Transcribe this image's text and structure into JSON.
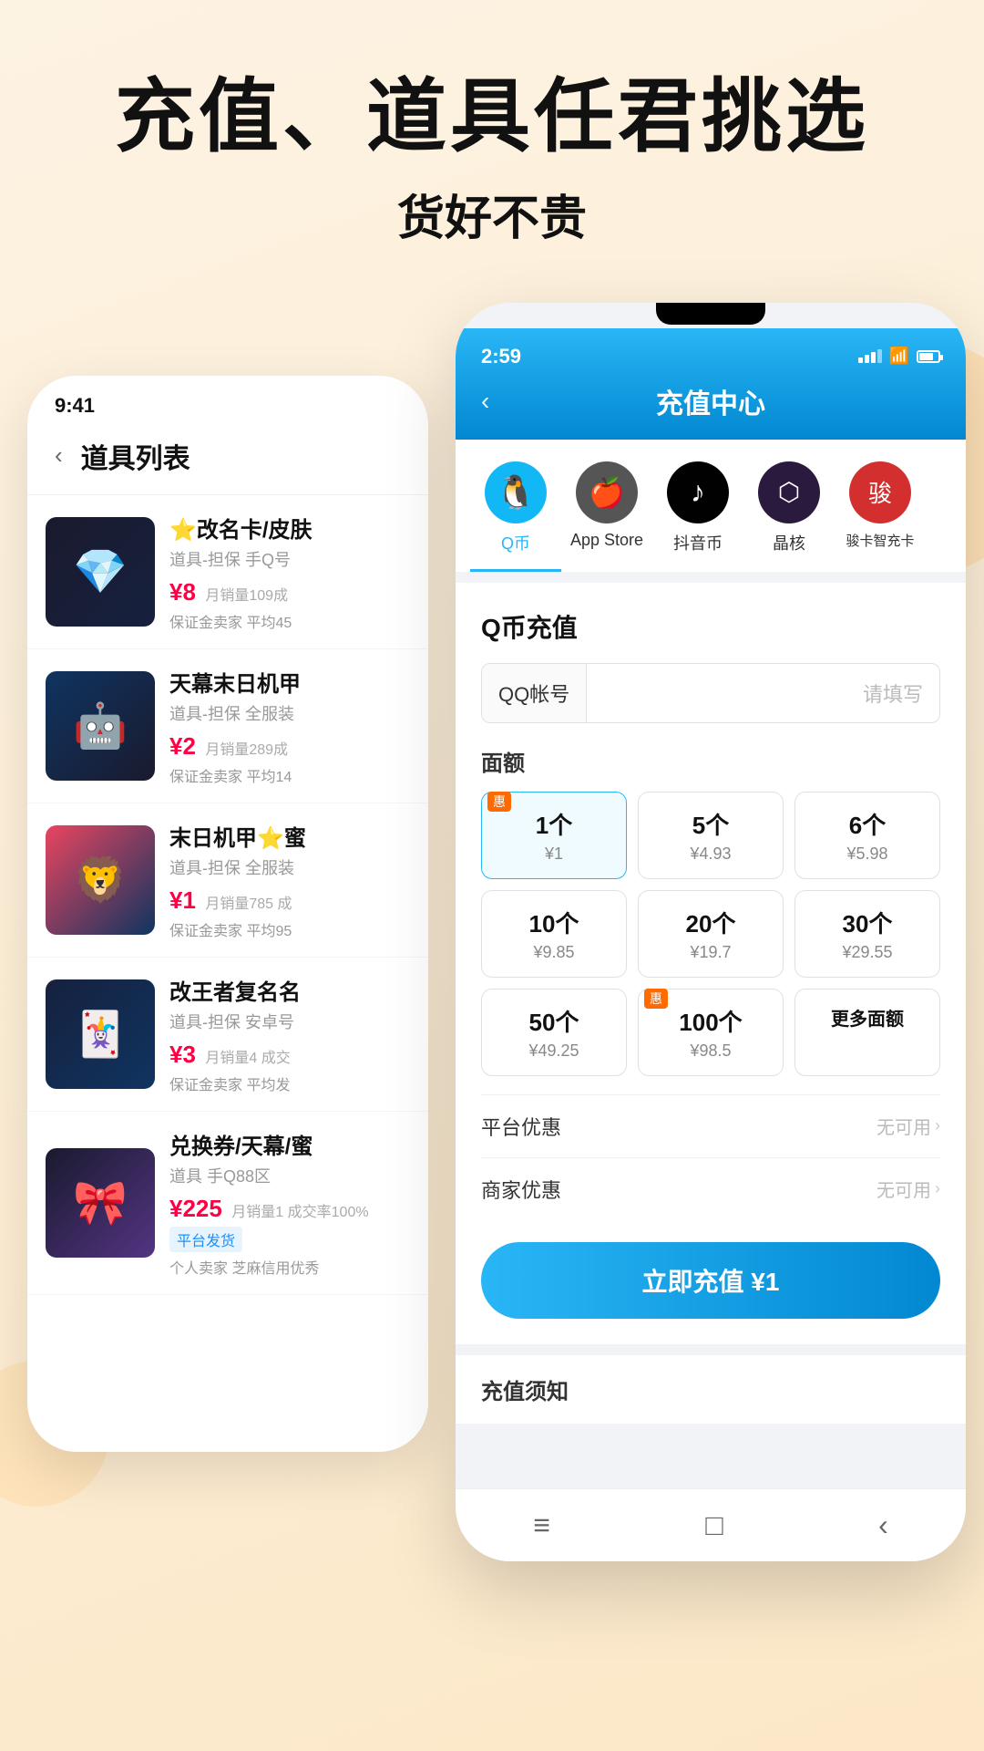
{
  "hero": {
    "title": "充值、道具任君挑选",
    "subtitle": "货好不贵"
  },
  "bg_phone": {
    "status_time": "9:41",
    "header_back": "‹",
    "header_title": "道具列表",
    "products": [
      {
        "id": 1,
        "img_class": "img1",
        "icon": "💎",
        "name": "⭐改名卡/皮肤",
        "desc": "道具-担保 手Q号",
        "price": "¥8",
        "sales": "月销量109成",
        "guarantee": "保证金卖家 平均45"
      },
      {
        "id": 2,
        "img_class": "img2",
        "icon": "🤖",
        "name": "天幕末日机甲",
        "desc": "道具-担保 全服装",
        "price": "¥2",
        "sales": "月销量289成",
        "guarantee": "保证金卖家 平均14"
      },
      {
        "id": 3,
        "img_class": "img3",
        "icon": "🦁",
        "name": "末日机甲⭐蜜",
        "desc": "道具-担保 全服装",
        "price": "¥1",
        "sales": "月销量785 成",
        "guarantee": "保证金卖家 平均95"
      },
      {
        "id": 4,
        "img_class": "img4",
        "icon": "🃏",
        "name": "改王者复名名",
        "desc": "道具-担保 安卓号",
        "price": "¥3",
        "sales": "月销量4 成交",
        "guarantee": "保证金卖家 平均发"
      },
      {
        "id": 5,
        "img_class": "img5",
        "icon": "🎀",
        "name": "兑换券/天幕/蜜",
        "desc": "道具 手Q88区",
        "price": "¥225",
        "sales": "月销量1 成交率100%",
        "guarantee": "平台发货",
        "extra": "个人卖家 芝麻信用优秀",
        "badge": "平台发货"
      }
    ]
  },
  "fg_phone": {
    "status_time": "2:59",
    "status_icons": [
      "signal",
      "wifi",
      "battery"
    ],
    "header_back": "‹",
    "header_title": "充值中心",
    "categories": [
      {
        "id": "qq",
        "icon": "🐧",
        "label": "Q币",
        "color": "qq",
        "active": true
      },
      {
        "id": "apple",
        "icon": "🍎",
        "label": "App Store",
        "color": "apple",
        "active": false
      },
      {
        "id": "douyin",
        "icon": "♪",
        "label": "抖音币",
        "color": "douyin",
        "active": false
      },
      {
        "id": "jinghe",
        "icon": "⬡",
        "label": "晶核",
        "color": "jinghe",
        "active": false
      },
      {
        "id": "junka",
        "icon": "🎮",
        "label": "骏卡智充卡",
        "color": "junka",
        "active": false
      }
    ],
    "recharge_title": "Q币充值",
    "account_label": "QQ帐号",
    "account_placeholder": "请填写",
    "denom_title": "面额",
    "denominations": [
      {
        "count": "1个",
        "price": "¥1",
        "selected": true,
        "badge": "惠"
      },
      {
        "count": "5个",
        "price": "¥4.93",
        "selected": false,
        "badge": ""
      },
      {
        "count": "6个",
        "price": "¥5.98",
        "selected": false,
        "badge": ""
      },
      {
        "count": "10个",
        "price": "¥9.85",
        "selected": false,
        "badge": ""
      },
      {
        "count": "20个",
        "price": "¥19.7",
        "selected": false,
        "badge": ""
      },
      {
        "count": "30个",
        "price": "¥29.55",
        "selected": false,
        "badge": ""
      },
      {
        "count": "50个",
        "price": "¥49.25",
        "selected": false,
        "badge": ""
      },
      {
        "count": "100个",
        "price": "¥98.5",
        "selected": false,
        "badge": "惠"
      },
      {
        "count": "更多面额",
        "price": "",
        "selected": false,
        "badge": ""
      }
    ],
    "platform_discount_label": "平台优惠",
    "platform_discount_value": "无可用",
    "merchant_discount_label": "商家优惠",
    "merchant_discount_value": "无可用",
    "cta_button": "立即充值 ¥1",
    "notice_title": "充值须知",
    "bottom_nav": [
      "≡",
      "□",
      "‹"
    ]
  }
}
